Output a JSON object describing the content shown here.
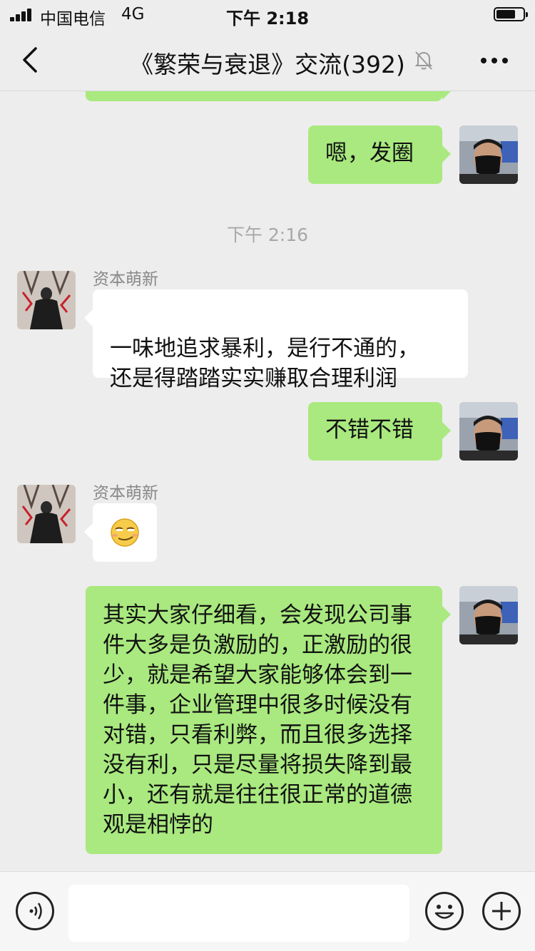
{
  "status_bar": {
    "carrier": "中国电信",
    "network": "4G",
    "time": "下午 2:18"
  },
  "nav": {
    "title": "《繁荣与衰退》交流(392)",
    "back_icon": "chevron-left-icon",
    "mute_icon": "bell-muted-icon",
    "more_icon": "more-dots-icon"
  },
  "messages": [
    {
      "side": "out",
      "text": "嗯，发圈"
    },
    {
      "timestamp": "下午 2:16"
    },
    {
      "side": "in",
      "sender": "资本萌新",
      "text": "一味地追求暴利，是行不通的，\n还是得踏踏实实赚取合理利润"
    },
    {
      "side": "out",
      "text": "不错不错"
    },
    {
      "side": "in",
      "sender": "资本萌新",
      "emoji": "smirk-emoji"
    },
    {
      "side": "out",
      "text": "其实大家仔细看，会发现公司事件大多是负激励的，正激励的很少，就是希望大家能够体会到一件事，企业管理中很多时候没有对错，只看利弊，而且很多选择没有利，只是尽量将损失降到最小，还有就是往往很正常的道德观是相悖的"
    }
  ],
  "input_bar": {
    "voice_icon": "voice-icon",
    "emoji_icon": "emoji-icon",
    "plus_icon": "plus-icon",
    "placeholder": ""
  },
  "colors": {
    "background": "#ededed",
    "outgoing_bubble": "#a9e97f",
    "incoming_bubble": "#ffffff"
  }
}
